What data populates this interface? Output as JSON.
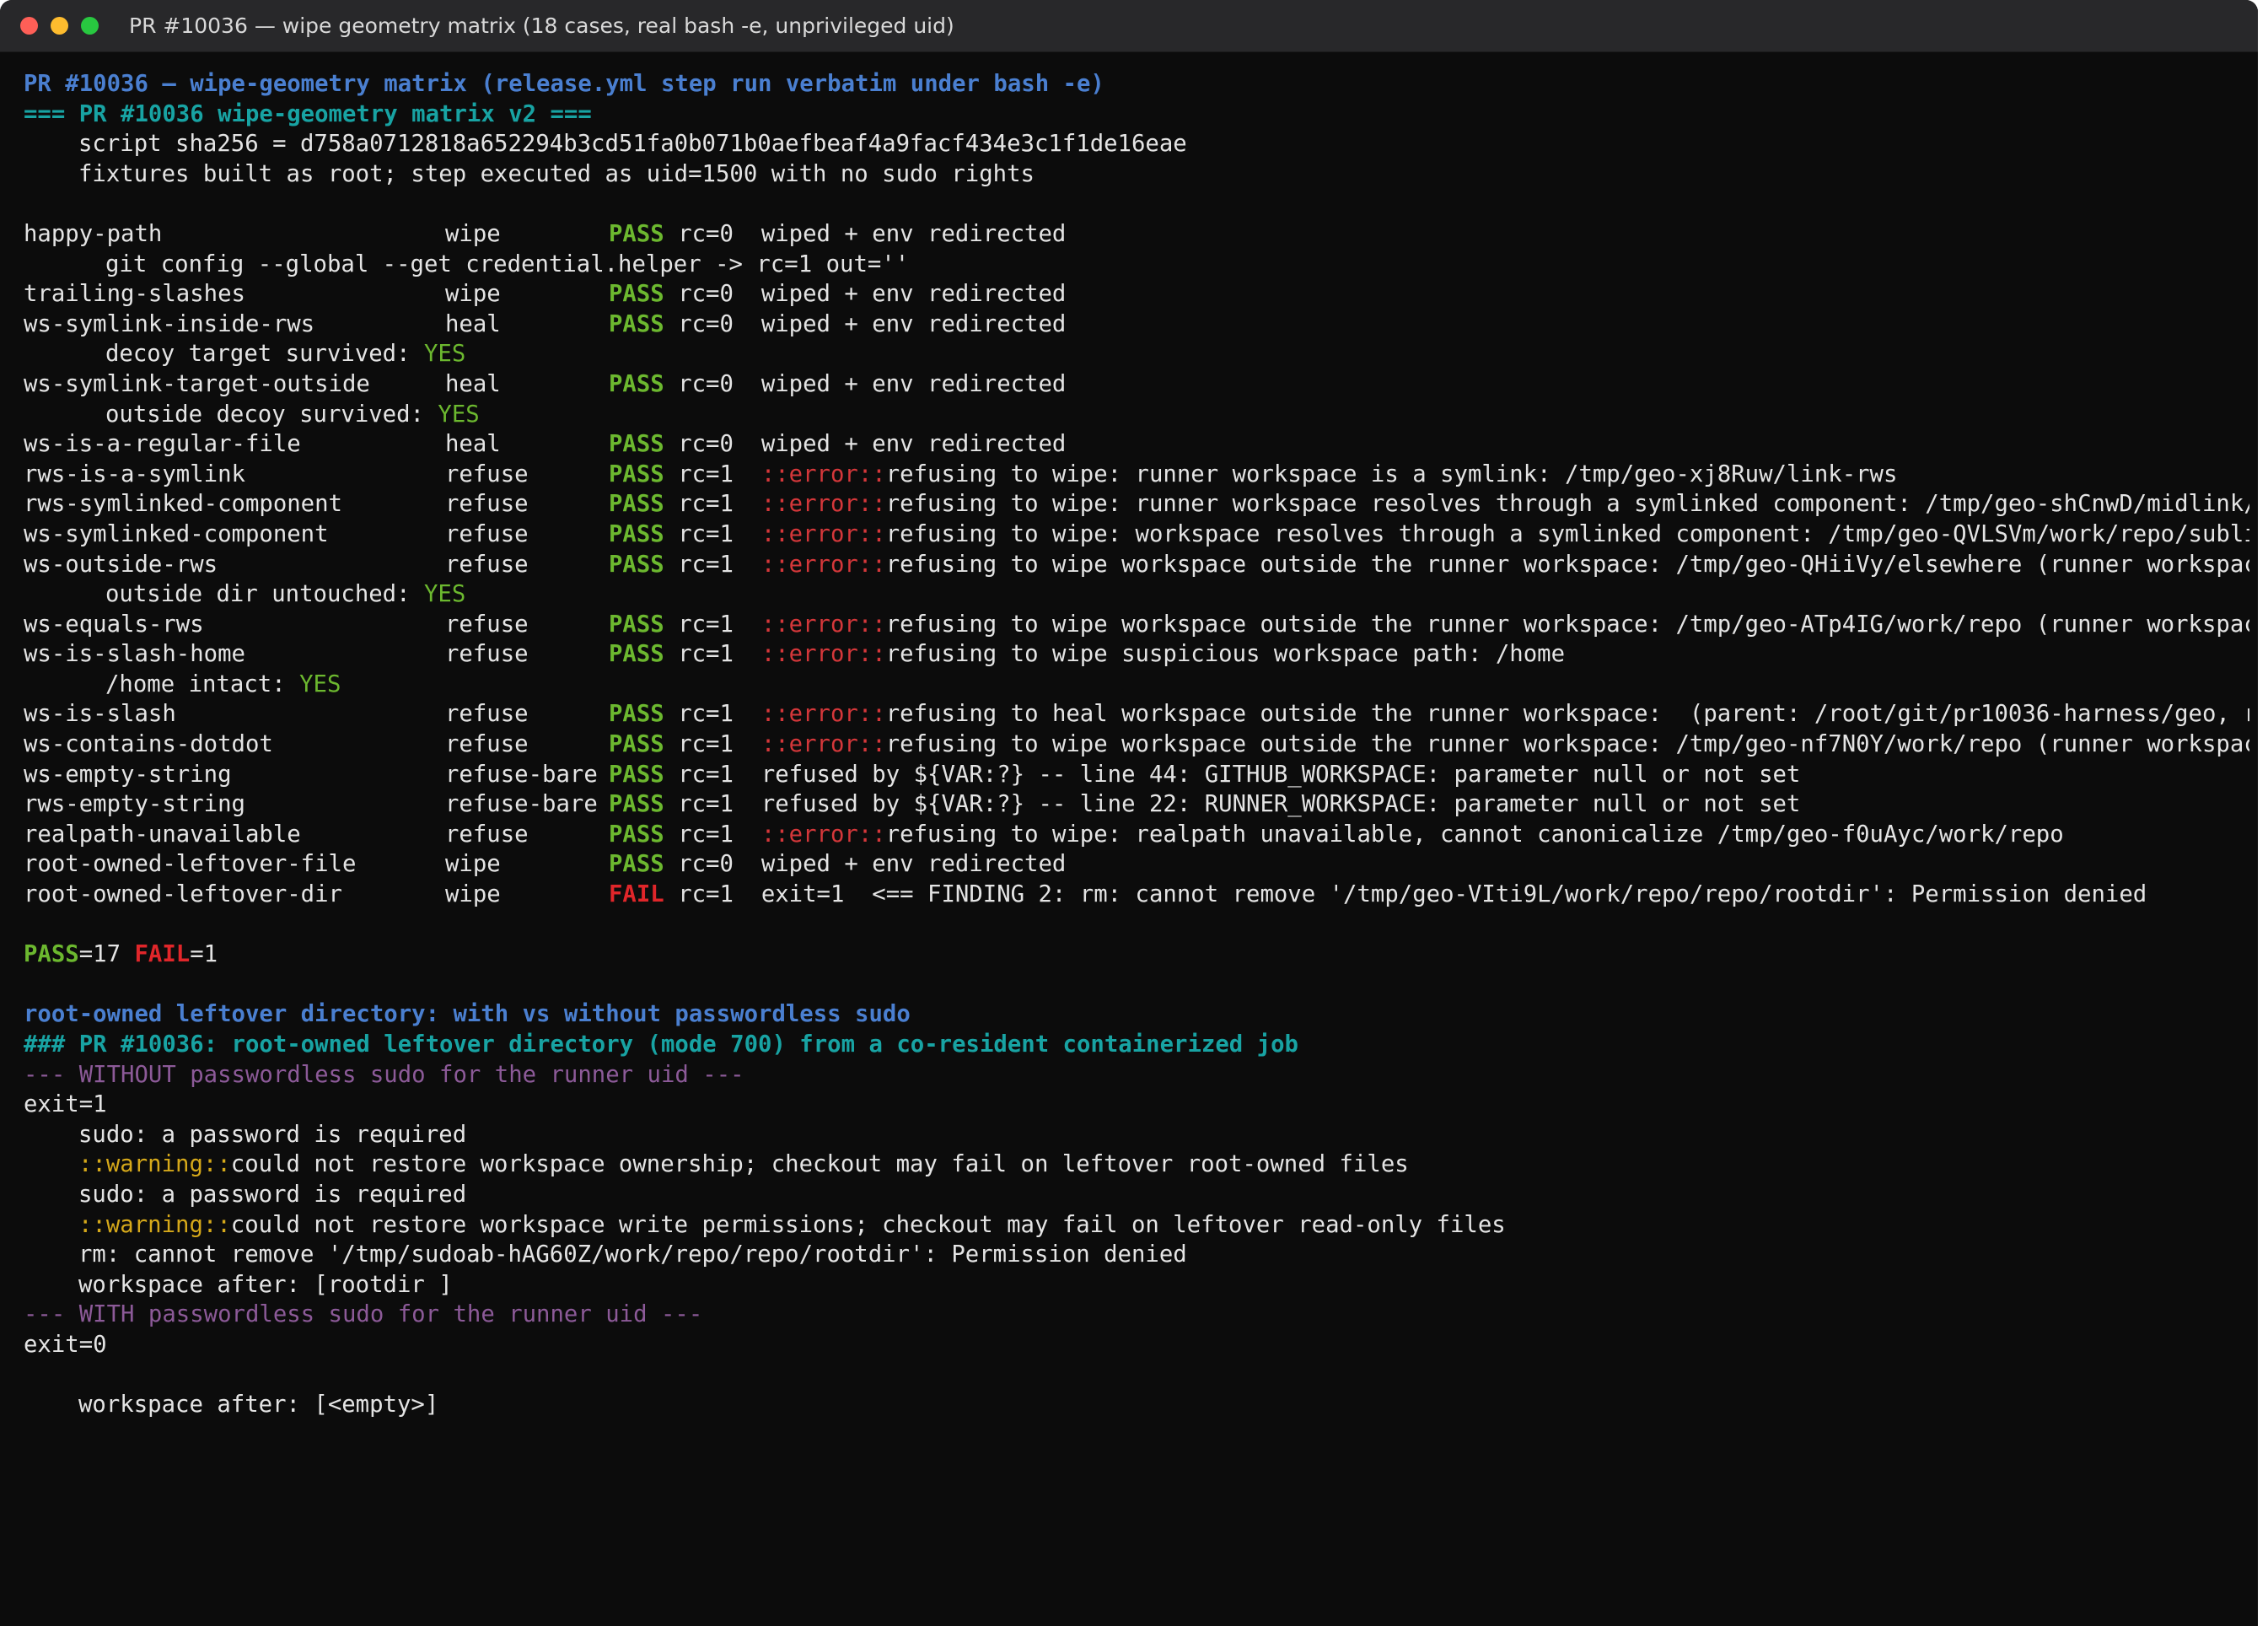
{
  "window": {
    "title": "PR #10036 — wipe geometry matrix (18 cases, real bash -e, unprivileged uid)"
  },
  "header": {
    "banner": "PR #10036 — wipe-geometry matrix (release.yml step run verbatim under bash -e)",
    "matrix_title": "=== PR #10036 wipe-geometry matrix v2 ===",
    "sha_line": "script sha256 = d758a0712818a652294b3cd51fa0b071b0aefbeaf4a9facf434e3c1f1de16eae",
    "fixtures_line": "fixtures built as root; step executed as uid=1500 with no sudo rights"
  },
  "matrix": {
    "rows": [
      {
        "name": "happy-path",
        "mode": "wipe",
        "status": "PASS",
        "rc": "rc=0",
        "msg_prefix": "",
        "msg": "wiped + env redirected",
        "sub": {
          "text": "git config --global --get credential.helper -> rc=1 out=''",
          "yes": ""
        }
      },
      {
        "name": "trailing-slashes",
        "mode": "wipe",
        "status": "PASS",
        "rc": "rc=0",
        "msg_prefix": "",
        "msg": "wiped + env redirected"
      },
      {
        "name": "ws-symlink-inside-rws",
        "mode": "heal",
        "status": "PASS",
        "rc": "rc=0",
        "msg_prefix": "",
        "msg": "wiped + env redirected",
        "sub": {
          "text": "decoy target survived: ",
          "yes": "YES"
        }
      },
      {
        "name": "ws-symlink-target-outside",
        "mode": "heal",
        "status": "PASS",
        "rc": "rc=0",
        "msg_prefix": "",
        "msg": "wiped + env redirected",
        "sub": {
          "text": "outside decoy survived: ",
          "yes": "YES"
        }
      },
      {
        "name": "ws-is-a-regular-file",
        "mode": "heal",
        "status": "PASS",
        "rc": "rc=0",
        "msg_prefix": "",
        "msg": "wiped + env redirected"
      },
      {
        "name": "rws-is-a-symlink",
        "mode": "refuse",
        "status": "PASS",
        "rc": "rc=1",
        "msg_prefix": "::error::",
        "msg": "refusing to wipe: runner workspace is a symlink: /tmp/geo-xj8Ruw/link-rws"
      },
      {
        "name": "rws-symlinked-component",
        "mode": "refuse",
        "status": "PASS",
        "rc": "rc=1",
        "msg_prefix": "::error::",
        "msg": "refusing to wipe: runner workspace resolves through a symlinked component: /tmp/geo-shCnwD/midlink/"
      },
      {
        "name": "ws-symlinked-component",
        "mode": "refuse",
        "status": "PASS",
        "rc": "rc=1",
        "msg_prefix": "::error::",
        "msg": "refusing to wipe: workspace resolves through a symlinked component: /tmp/geo-QVLSVm/work/repo/subli"
      },
      {
        "name": "ws-outside-rws",
        "mode": "refuse",
        "status": "PASS",
        "rc": "rc=1",
        "msg_prefix": "::error::",
        "msg": "refusing to wipe workspace outside the runner workspace: /tmp/geo-QHiiVy/elsewhere (runner workspac",
        "sub": {
          "text": "outside dir untouched: ",
          "yes": "YES"
        }
      },
      {
        "name": "ws-equals-rws",
        "mode": "refuse",
        "status": "PASS",
        "rc": "rc=1",
        "msg_prefix": "::error::",
        "msg": "refusing to wipe workspace outside the runner workspace: /tmp/geo-ATp4IG/work/repo (runner workspac"
      },
      {
        "name": "ws-is-slash-home",
        "mode": "refuse",
        "status": "PASS",
        "rc": "rc=1",
        "msg_prefix": "::error::",
        "msg": "refusing to wipe suspicious workspace path: /home",
        "sub": {
          "text": "/home intact: ",
          "yes": "YES"
        }
      },
      {
        "name": "ws-is-slash",
        "mode": "refuse",
        "status": "PASS",
        "rc": "rc=1",
        "msg_prefix": "::error::",
        "msg": "refusing to heal workspace outside the runner workspace:  (parent: /root/git/pr10036-harness/geo, r"
      },
      {
        "name": "ws-contains-dotdot",
        "mode": "refuse",
        "status": "PASS",
        "rc": "rc=1",
        "msg_prefix": "::error::",
        "msg": "refusing to wipe workspace outside the runner workspace: /tmp/geo-nf7N0Y/work/repo (runner workspac"
      },
      {
        "name": "ws-empty-string",
        "mode": "refuse-bare",
        "status": "PASS",
        "rc": "rc=1",
        "msg_prefix": "",
        "msg": "refused by ${VAR:?} -- line 44: GITHUB_WORKSPACE: parameter null or not set"
      },
      {
        "name": "rws-empty-string",
        "mode": "refuse-bare",
        "status": "PASS",
        "rc": "rc=1",
        "msg_prefix": "",
        "msg": "refused by ${VAR:?} -- line 22: RUNNER_WORKSPACE: parameter null or not set"
      },
      {
        "name": "realpath-unavailable",
        "mode": "refuse",
        "status": "PASS",
        "rc": "rc=1",
        "msg_prefix": "::error::",
        "msg": "refusing to wipe: realpath unavailable, cannot canonicalize /tmp/geo-f0uAyc/work/repo"
      },
      {
        "name": "root-owned-leftover-file",
        "mode": "wipe",
        "status": "PASS",
        "rc": "rc=0",
        "msg_prefix": "",
        "msg": "wiped + env redirected"
      },
      {
        "name": "root-owned-leftover-dir",
        "mode": "wipe",
        "status": "FAIL",
        "rc": "rc=1",
        "msg_prefix": "",
        "msg": "exit=1  <== FINDING 2: rm: cannot remove '/tmp/geo-VIti9L/work/repo/repo/rootdir': Permission denied"
      }
    ]
  },
  "summary": {
    "pass_label": "PASS",
    "pass_count": "=17",
    "fail_label": "FAIL",
    "fail_count": "=1"
  },
  "leftover": {
    "banner": "root-owned leftover directory: with vs without passwordless sudo",
    "heading": "### PR #10036: root-owned leftover directory (mode 700) from a co-resident containerized job",
    "without_header": "--- WITHOUT passwordless sudo for the runner uid ---",
    "without_exit": "exit=1",
    "without_lines": [
      {
        "prefix": "",
        "text": "sudo: a password is required"
      },
      {
        "prefix": "::warning::",
        "text": "could not restore workspace ownership; checkout may fail on leftover root-owned files"
      },
      {
        "prefix": "",
        "text": "sudo: a password is required"
      },
      {
        "prefix": "::warning::",
        "text": "could not restore workspace write permissions; checkout may fail on leftover read-only files"
      },
      {
        "prefix": "",
        "text": "rm: cannot remove '/tmp/sudoab-hAG60Z/work/repo/repo/rootdir': Permission denied"
      },
      {
        "prefix": "",
        "text": "workspace after: [rootdir ]"
      }
    ],
    "with_header": "--- WITH passwordless sudo for the runner uid ---",
    "with_exit": "exit=0",
    "with_after": "workspace after: [<empty>]"
  }
}
